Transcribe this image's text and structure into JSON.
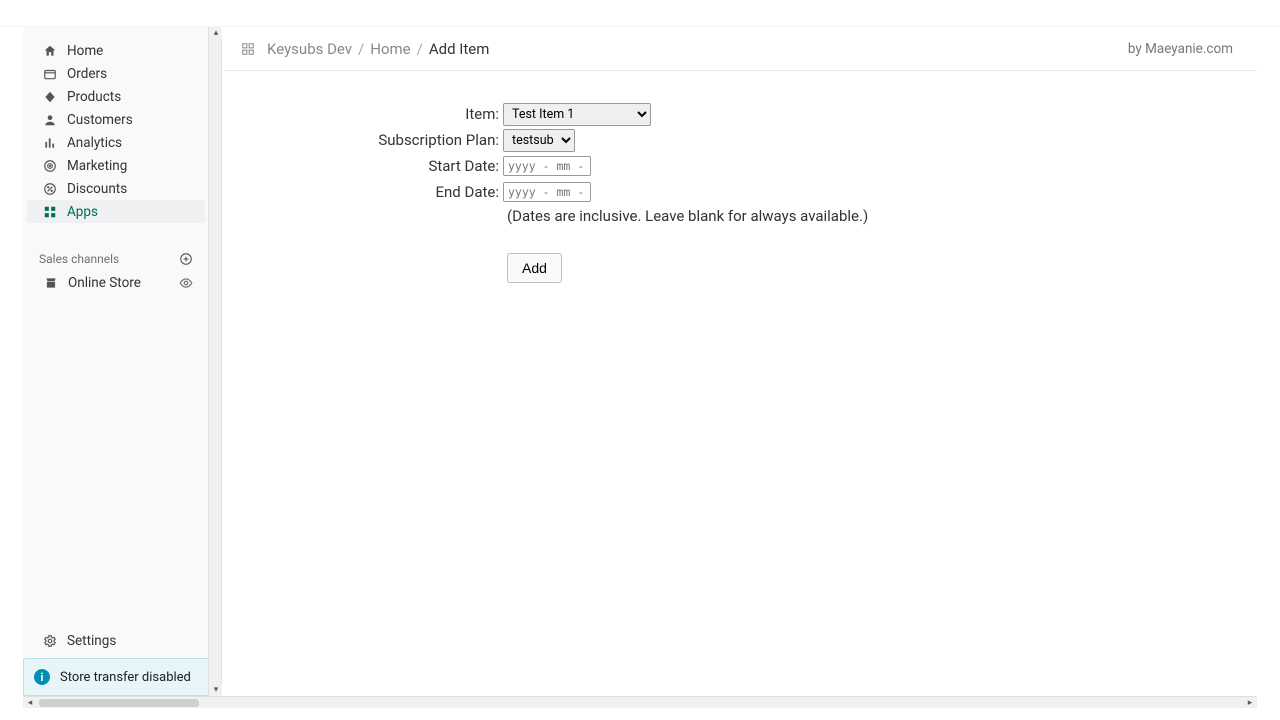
{
  "sidebar": {
    "items": [
      {
        "label": "Home"
      },
      {
        "label": "Orders"
      },
      {
        "label": "Products"
      },
      {
        "label": "Customers"
      },
      {
        "label": "Analytics"
      },
      {
        "label": "Marketing"
      },
      {
        "label": "Discounts"
      },
      {
        "label": "Apps"
      }
    ],
    "section_header": "Sales channels",
    "online_store": "Online Store",
    "settings": "Settings",
    "notice": "Store transfer disabled"
  },
  "header": {
    "breadcrumb_app": "Keysubs Dev",
    "breadcrumb_home": "Home",
    "breadcrumb_current": "Add Item",
    "byline": "by Maeyanie.com"
  },
  "form": {
    "item_label": "Item:",
    "item_value": "Test Item 1",
    "plan_label": "Subscription Plan:",
    "plan_value": "testsub",
    "start_label": "Start Date:",
    "start_placeholder": "yyyy - mm - dd",
    "end_label": "End Date:",
    "end_placeholder": "yyyy - mm - dd",
    "help": "(Dates are inclusive. Leave blank for always available.)",
    "add_button": "Add"
  }
}
